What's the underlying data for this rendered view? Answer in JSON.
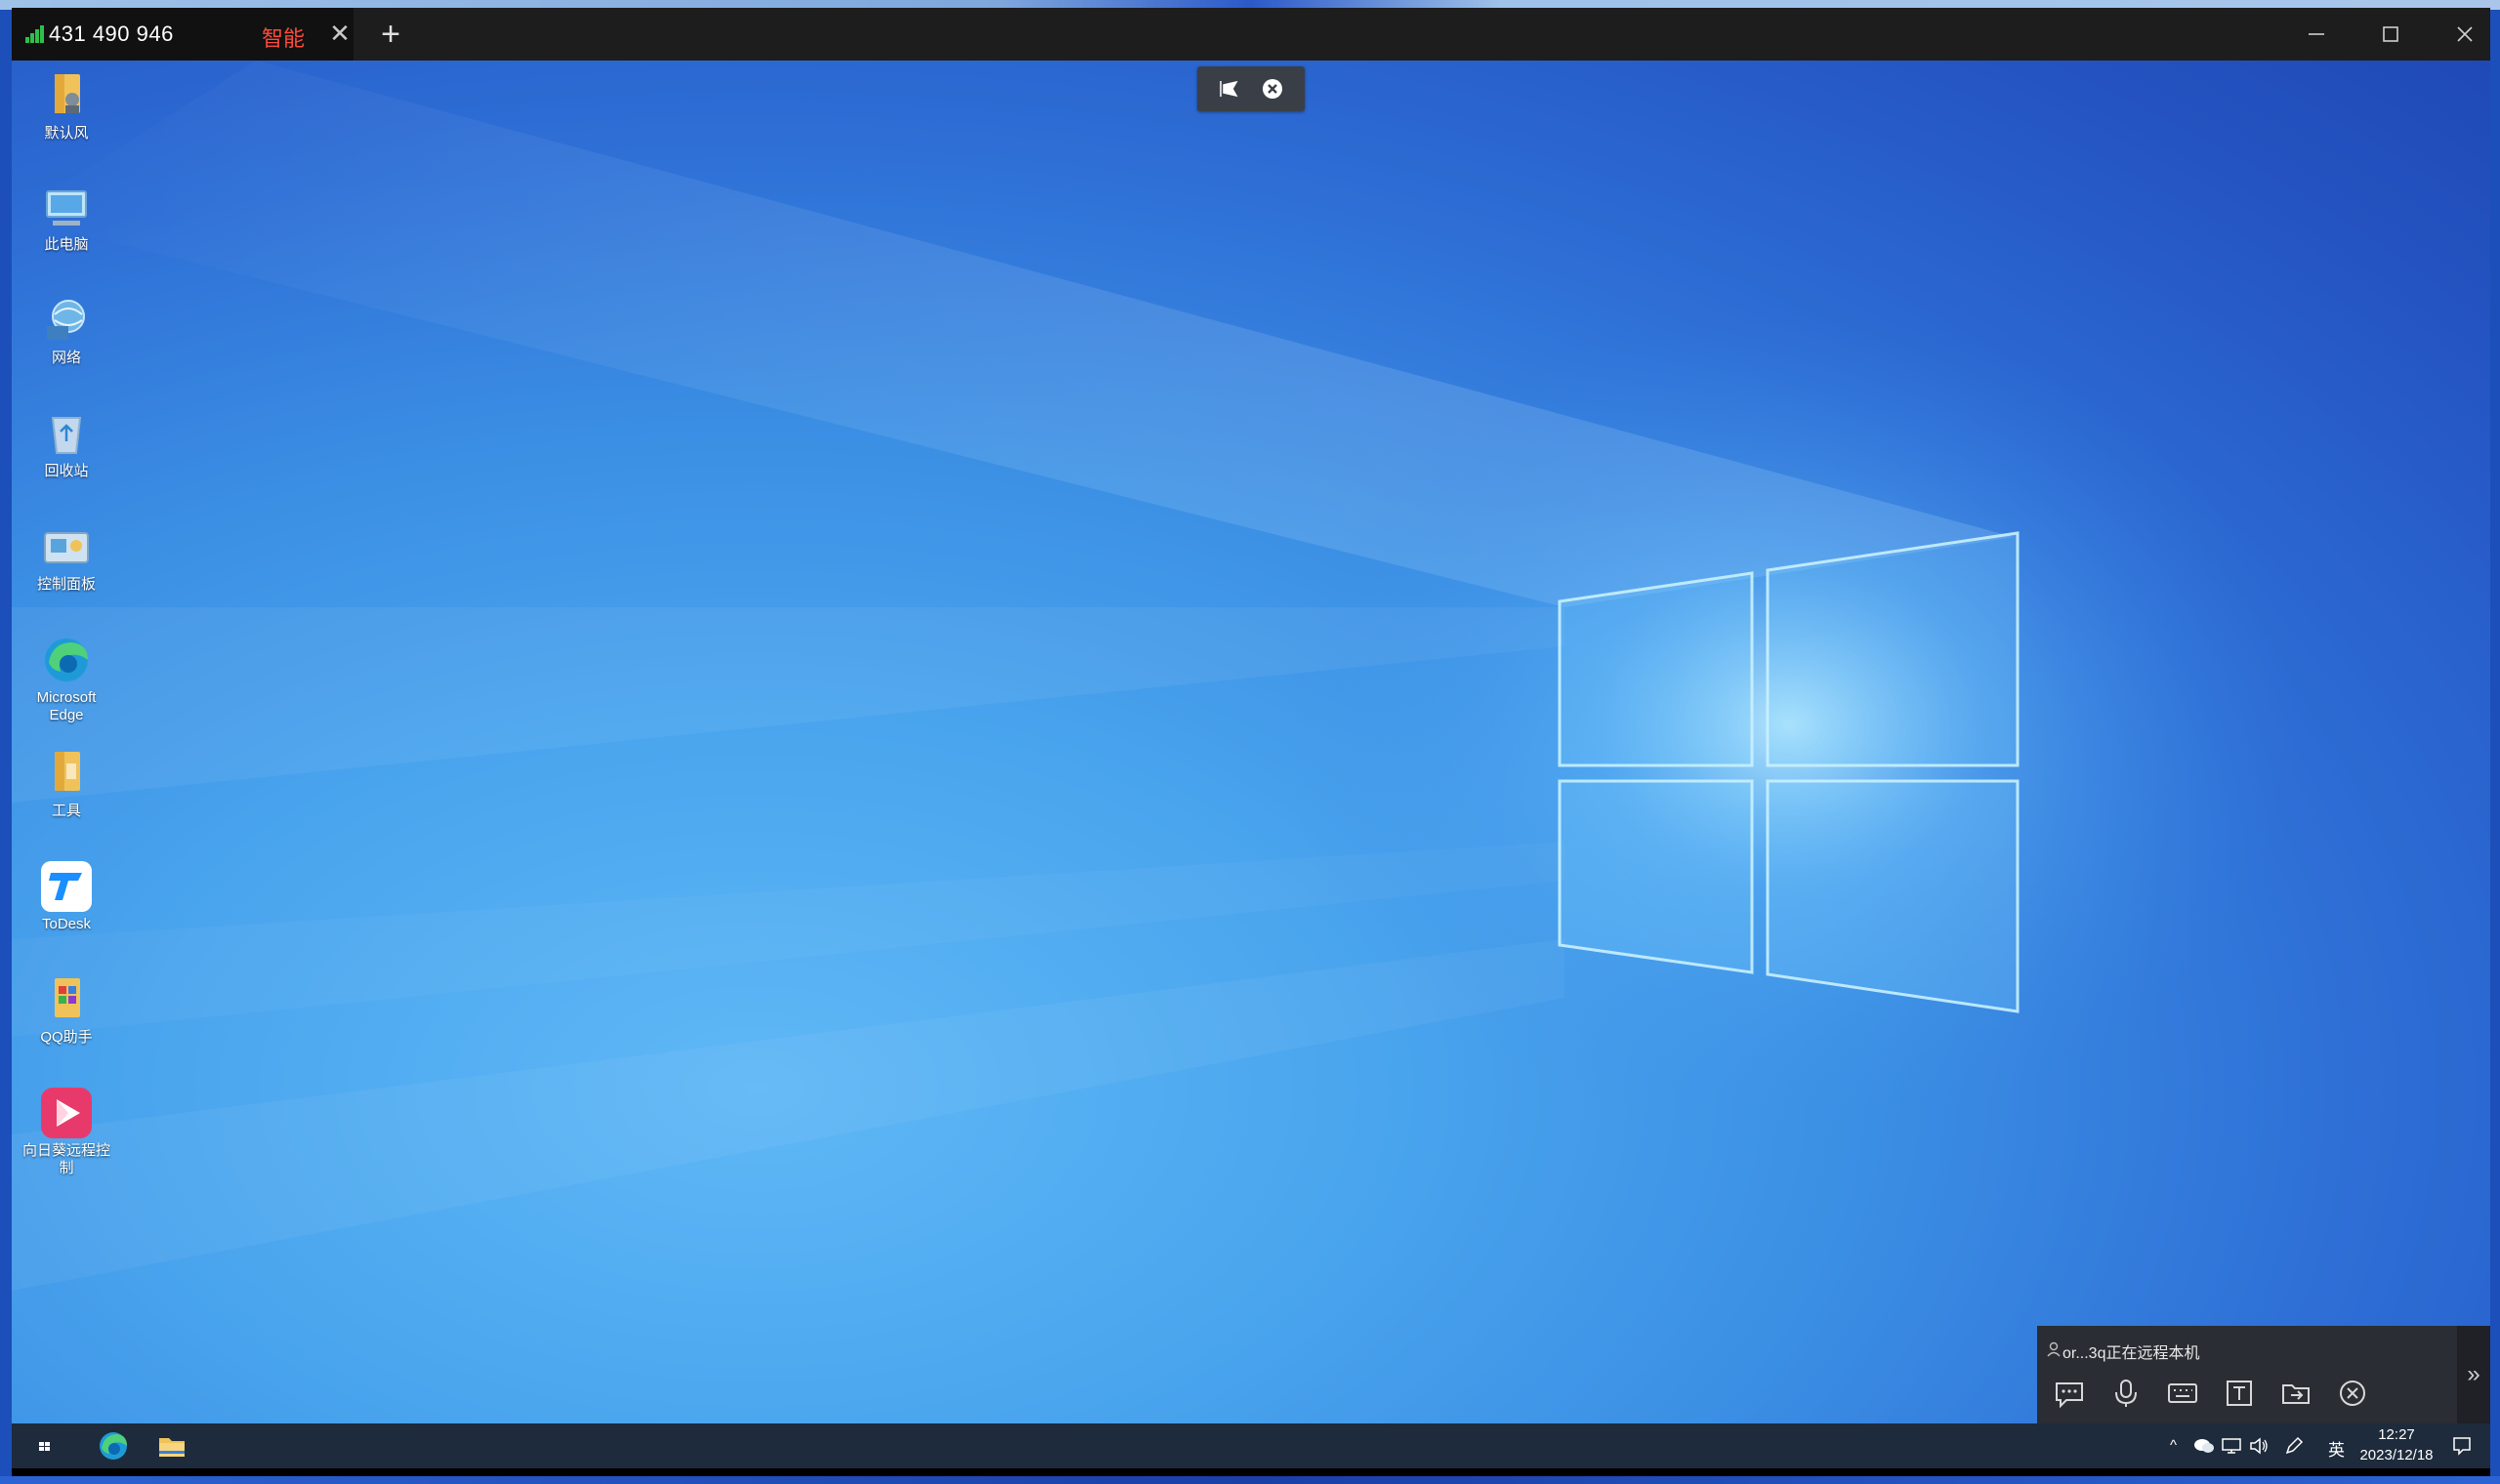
{
  "client": {
    "tab_title": "431 490 946",
    "tab_mode": "智能",
    "tab_close": "✕",
    "new_tab": "+",
    "minimize": "—",
    "maximize": "☐",
    "close": "✕"
  },
  "desktop_icons": [
    {
      "label": "默认风",
      "icon": "user-folder-icon"
    },
    {
      "label": "此电脑",
      "icon": "computer-icon"
    },
    {
      "label": "网络",
      "icon": "network-icon"
    },
    {
      "label": "回收站",
      "icon": "recycle-bin-icon"
    },
    {
      "label": "控制面板",
      "icon": "control-panel-icon"
    },
    {
      "label": "Microsoft Edge",
      "icon": "edge-icon"
    },
    {
      "label": "工具",
      "icon": "folder-icon"
    },
    {
      "label": "ToDesk",
      "icon": "todesk-icon"
    },
    {
      "label": "QQ助手",
      "icon": "qq-assistant-icon"
    },
    {
      "label": "向日葵远程控制",
      "icon": "sunlogin-icon"
    }
  ],
  "session_panel": {
    "status_text": "or...3q正在远程本机",
    "buttons": [
      "chat-icon",
      "microphone-icon",
      "keyboard-icon",
      "text-icon",
      "file-transfer-icon",
      "disconnect-icon"
    ],
    "collapse": "»"
  },
  "taskbar": {
    "ime": "英",
    "time": "12:27",
    "date": "2023/12/18",
    "tray_expand": "^"
  },
  "colors": {
    "titlebar": "#1d1d1d",
    "tab_mode_color": "#ff4a3d",
    "signal_color": "#2fbf4a",
    "taskbar": "#1e2b3c"
  }
}
